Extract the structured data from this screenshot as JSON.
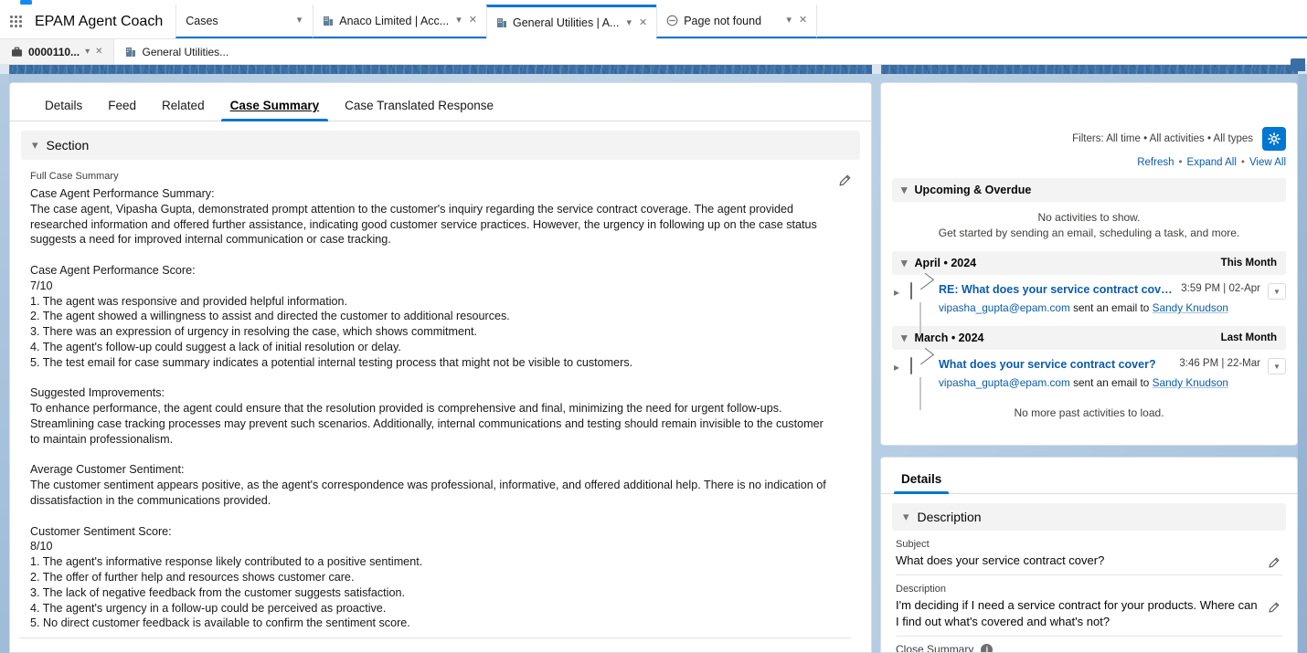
{
  "browser": {
    "app_name": "EPAM Agent Coach",
    "nav_tab": {
      "label": "Cases",
      "chevron": "chevron-down"
    },
    "tabs": [
      {
        "label": "Anaco Limited | Acc...",
        "icon": "account-icon",
        "active": false
      },
      {
        "label": "General Utilities | A...",
        "icon": "account-icon",
        "active": true
      },
      {
        "label": "Page not found",
        "icon": "error-circle-icon",
        "active": false
      }
    ],
    "subtabs": [
      {
        "label": "0000110...",
        "icon": "case-briefcase-icon",
        "active": true
      },
      {
        "label": "General Utilities...",
        "icon": "account-icon",
        "active": false
      }
    ]
  },
  "main": {
    "tabs": [
      {
        "label": "Details",
        "active": false
      },
      {
        "label": "Feed",
        "active": false
      },
      {
        "label": "Related",
        "active": false
      },
      {
        "label": "Case Summary",
        "active": true
      },
      {
        "label": "Case Translated Response",
        "active": false
      }
    ],
    "section": {
      "title": "Section",
      "collapse_icon": "chevron-down-icon"
    },
    "full_case_summary": {
      "label": "Full Case Summary",
      "edit_icon": "pencil-icon",
      "text": "Case Agent Performance Summary:\nThe case agent, Vipasha Gupta, demonstrated prompt attention to the customer's inquiry regarding the service contract coverage. The agent provided researched information and offered further assistance, indicating good customer service practices. However, the urgency in following up on the case status suggests a need for improved internal communication or case tracking.\n\nCase Agent Performance Score:\n7/10\n1. The agent was responsive and provided helpful information.\n2. The agent showed a willingness to assist and directed the customer to additional resources.\n3. There was an expression of urgency in resolving the case, which shows commitment.\n4. The agent's follow-up could suggest a lack of initial resolution or delay.\n5. The test email for case summary indicates a potential internal testing process that might not be visible to customers.\n\nSuggested Improvements:\nTo enhance performance, the agent could ensure that the resolution provided is comprehensive and final, minimizing the need for urgent follow-ups. Streamlining case tracking processes may prevent such scenarios. Additionally, internal communications and testing should remain invisible to the customer to maintain professionalism.\n\nAverage Customer Sentiment:\nThe customer sentiment appears positive, as the agent's correspondence was professional, informative, and offered additional help. There is no indication of dissatisfaction in the communications provided.\n\nCustomer Sentiment Score:\n8/10\n1. The agent's informative response likely contributed to a positive sentiment.\n2. The offer of further help and resources shows customer care.\n3. The lack of negative feedback from the customer suggests satisfaction.\n4. The agent's urgency in a follow-up could be perceived as proactive.\n5. No direct customer feedback is available to confirm the sentiment score."
    }
  },
  "activity": {
    "filters_text": "Filters: All time • All activities • All types",
    "settings_icon": "gear-icon",
    "links": [
      "Refresh",
      "Expand All",
      "View All"
    ],
    "upcoming": {
      "title": "Upcoming & Overdue",
      "empty_line1": "No activities to show.",
      "empty_line2": "Get started by sending an email, scheduling a task, and more."
    },
    "groups": [
      {
        "title": "April • 2024",
        "tag": "This Month",
        "items": [
          {
            "icon": "email-icon",
            "title": "RE: What does your service contract cover?",
            "time": "3:59 PM | 02-Apr",
            "actor": "vipasha_gupta@epam.com",
            "action": "sent an email to",
            "recipient": "Sandy Knudson",
            "menu_icon": "chevron-down-icon"
          }
        ]
      },
      {
        "title": "March • 2024",
        "tag": "Last Month",
        "items": [
          {
            "icon": "email-icon",
            "title": "What does your service contract cover?",
            "time": "3:46 PM | 22-Mar",
            "actor": "vipasha_gupta@epam.com",
            "action": "sent an email to",
            "recipient": "Sandy Knudson",
            "menu_icon": "chevron-down-icon"
          }
        ]
      }
    ],
    "no_more": "No more past activities to load."
  },
  "details": {
    "tab_label": "Details",
    "description_section": {
      "title": "Description",
      "collapse_icon": "chevron-down-icon"
    },
    "fields": [
      {
        "label": "Subject",
        "value": "What does your service contract cover?",
        "edit_icon": "pencil-icon"
      },
      {
        "label": "Description",
        "value": "I'm deciding if I need a service contract for your products. Where can I find out what's covered and what's not?",
        "edit_icon": "pencil-icon"
      }
    ],
    "close_summary": {
      "label": "Close Summary",
      "info_icon": "info-icon"
    }
  },
  "colors": {
    "accent_blue": "#0176d3",
    "link_blue": "#0b5cab",
    "band_blue": "#3a6ea5",
    "panel_bg": "#f3f3f3"
  }
}
